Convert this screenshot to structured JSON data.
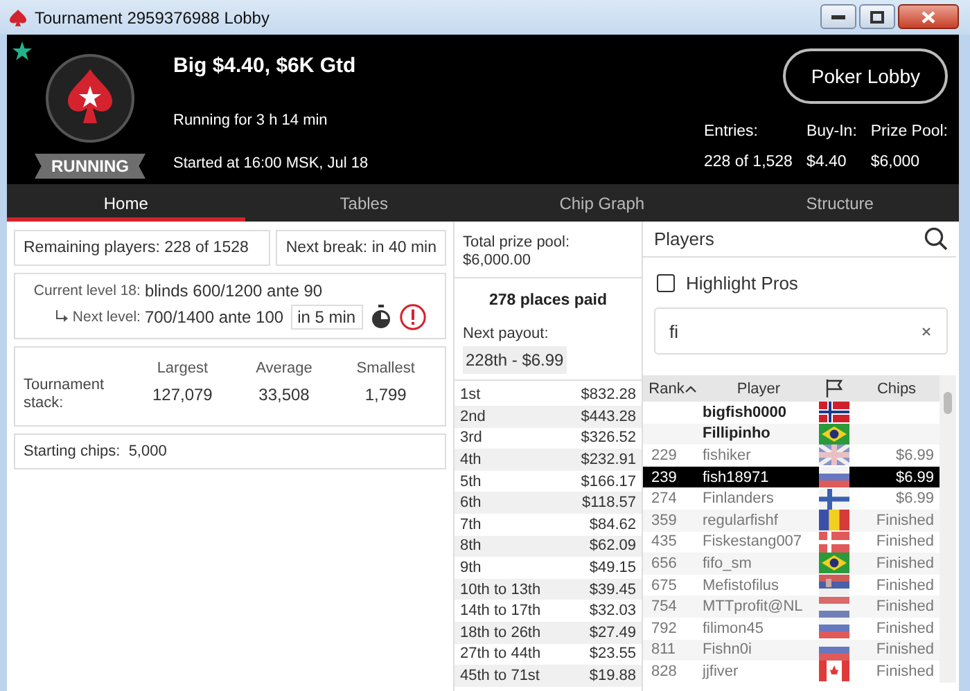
{
  "window": {
    "title": "Tournament 2959376988 Lobby"
  },
  "header": {
    "status": "RUNNING",
    "name": "Big $4.40, $6K Gtd",
    "running_for": "Running for 3 h 14 min",
    "started": "Started at 16:00 MSK, Jul 18",
    "lobby_button": "Poker Lobby",
    "stats": [
      {
        "label": "Entries:",
        "value": "228 of 1,528"
      },
      {
        "label": "Buy-In:",
        "value": "$4.40"
      },
      {
        "label": "Prize Pool:",
        "value": "$6,000"
      }
    ]
  },
  "tabs": [
    {
      "label": "Home",
      "selected": true
    },
    {
      "label": "Tables",
      "selected": false
    },
    {
      "label": "Chip Graph",
      "selected": false
    },
    {
      "label": "Structure",
      "selected": false
    }
  ],
  "info": {
    "remaining": "Remaining players: 228 of 1528",
    "next_break": "Next break: in 40 min",
    "current_level_label": "Current level 18:",
    "current_level": "blinds 600/1200 ante 90",
    "next_level_label": "Next level:",
    "next_level": "700/1400 ante 100",
    "next_level_time": "in 5 min",
    "stack_label": "Tournament stack:",
    "stack": [
      {
        "heading": "Largest",
        "value": "127,079"
      },
      {
        "heading": "Average",
        "value": "33,508"
      },
      {
        "heading": "Smallest",
        "value": "1,799"
      }
    ],
    "starting_chips_label": "Starting chips:",
    "starting_chips": "5,000"
  },
  "payouts": {
    "total_label": "Total prize pool:",
    "total": "$6,000.00",
    "places_paid": "278 places paid",
    "next_label": "Next payout:",
    "next": "228th - $6.99",
    "rows": [
      {
        "place": "1st",
        "amount": "$832.28"
      },
      {
        "place": "2nd",
        "amount": "$443.28"
      },
      {
        "place": "3rd",
        "amount": "$326.52"
      },
      {
        "place": "4th",
        "amount": "$232.91"
      },
      {
        "place": "5th",
        "amount": "$166.17"
      },
      {
        "place": "6th",
        "amount": "$118.57"
      },
      {
        "place": "7th",
        "amount": "$84.62"
      },
      {
        "place": "8th",
        "amount": "$62.09"
      },
      {
        "place": "9th",
        "amount": "$49.15"
      },
      {
        "place": "10th to 13th",
        "amount": "$39.45"
      },
      {
        "place": "14th to 17th",
        "amount": "$32.03"
      },
      {
        "place": "18th to 26th",
        "amount": "$27.49"
      },
      {
        "place": "27th to 44th",
        "amount": "$23.55"
      },
      {
        "place": "45th to 71st",
        "amount": "$19.88"
      }
    ]
  },
  "players": {
    "title": "Players",
    "highlight_pros": {
      "label": "Highlight Pros",
      "checked": false
    },
    "search": {
      "value": "fi"
    },
    "columns": [
      {
        "kind": "text",
        "label": "Rank",
        "sorted": true
      },
      {
        "kind": "text",
        "label": "Player",
        "sorted": false
      },
      {
        "kind": "flag",
        "sorted": false
      },
      {
        "kind": "text",
        "label": "Chips",
        "sorted": false
      }
    ],
    "rows": [
      {
        "rank": "",
        "player": "bigfish0000",
        "kind": "norway",
        "chips": "",
        "bold": true,
        "selected": false
      },
      {
        "rank": "",
        "player": "Fillipinho",
        "kind": "brazil",
        "chips": "",
        "bold": true,
        "selected": false
      },
      {
        "rank": "229",
        "player": "fishiker",
        "kind": "uk",
        "chips": "$6.99",
        "bold": false,
        "selected": false
      },
      {
        "rank": "239",
        "player": "fish18971",
        "kind": "russia",
        "chips": "$6.99",
        "bold": false,
        "selected": true
      },
      {
        "rank": "274",
        "player": "Finlanders",
        "kind": "finland",
        "chips": "$6.99",
        "bold": false,
        "selected": false
      },
      {
        "rank": "359",
        "player": "regularfishf",
        "kind": "romania",
        "chips": "Finished",
        "bold": false,
        "selected": false
      },
      {
        "rank": "435",
        "player": "Fiskestang007",
        "kind": "denmark",
        "chips": "Finished",
        "bold": false,
        "selected": false
      },
      {
        "rank": "656",
        "player": "fifo_sm",
        "kind": "brazil",
        "chips": "Finished",
        "bold": false,
        "selected": false
      },
      {
        "rank": "675",
        "player": "Mefistofilus",
        "kind": "serbia",
        "chips": "Finished",
        "bold": false,
        "selected": false
      },
      {
        "rank": "754",
        "player": "MTTprofit@NL",
        "kind": "netherlands",
        "chips": "Finished",
        "bold": false,
        "selected": false
      },
      {
        "rank": "792",
        "player": "filimon45",
        "kind": "russia",
        "chips": "Finished",
        "bold": false,
        "selected": false
      },
      {
        "rank": "811",
        "player": "Fishn0i",
        "kind": "russia",
        "chips": "Finished",
        "bold": false,
        "selected": false
      },
      {
        "rank": "828",
        "player": "jjfiver",
        "kind": "canada",
        "chips": "Finished",
        "bold": false,
        "selected": false
      }
    ]
  }
}
